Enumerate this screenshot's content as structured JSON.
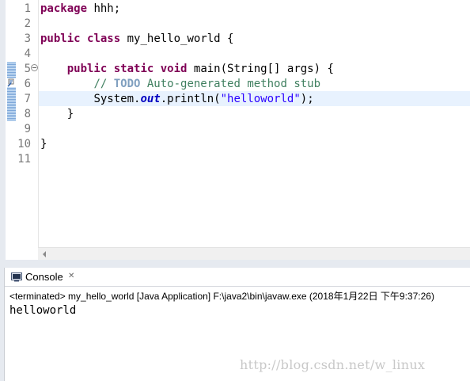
{
  "editor": {
    "line_numbers": [
      "1",
      "2",
      "3",
      "4",
      "5",
      "6",
      "7",
      "8",
      "9",
      "10",
      "11"
    ],
    "line1": {
      "kw": "package",
      "rest": " hhh;"
    },
    "line3": {
      "kw1": "public",
      "kw2": "class",
      "rest": " my_hello_world {"
    },
    "line5": {
      "indent": "    ",
      "kw1": "public",
      "kw2": "static",
      "kw3": "void",
      "rest": " main(String[] args) {"
    },
    "line6": {
      "indent": "        ",
      "comment_start": "// ",
      "todo": "TODO",
      "comment_end": " Auto-generated method stub"
    },
    "line7": {
      "indent": "        ",
      "prefix": "System.",
      "field": "out",
      "mid": ".println(",
      "str": "\"helloworld\"",
      "end": ");"
    },
    "line8": {
      "text": "    }"
    },
    "line10": {
      "text": "}"
    }
  },
  "console": {
    "tab_label": "Console",
    "close_glyph": "✕",
    "status": "<terminated> my_hello_world [Java Application] F:\\java2\\bin\\javaw.exe (2018年1月22日 下午9:37:26)",
    "output": "helloworld"
  },
  "watermark": "http://blog.csdn.net/w_linux",
  "colors": {
    "keyword": "#7f0055",
    "comment": "#3f7f5f",
    "todo": "#7f9fbf",
    "string": "#2a00ff",
    "field": "#0000c0",
    "current_line": "#e8f2fe"
  },
  "icons": [
    "fold-collapse-icon",
    "console-icon",
    "close-icon",
    "change-marker",
    "warning-marker",
    "scroll-left-arrow-icon"
  ]
}
